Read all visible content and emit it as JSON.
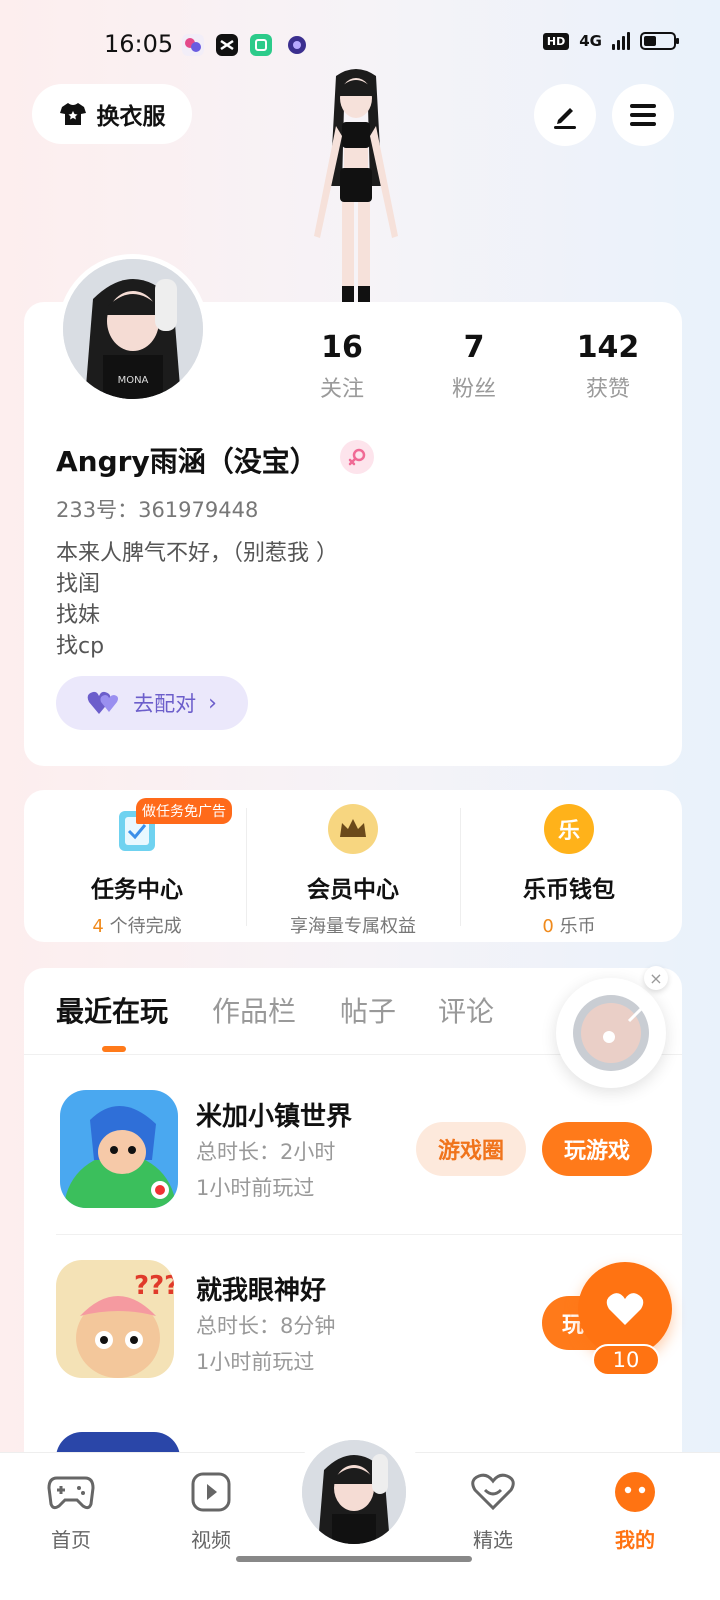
{
  "status_bar": {
    "time": "16:05",
    "network": "4G",
    "hd": "HD",
    "app_icons": [
      "app-icon-1",
      "capcut-icon",
      "app-icon-3",
      "app-icon-4"
    ]
  },
  "top_bar": {
    "outfit_label": "换衣服",
    "edit_icon": "pen-icon",
    "menu_icon": "menu-icon"
  },
  "profile": {
    "name": "Angry雨涵（没宝）",
    "gender_icon": "female-icon",
    "uid": "233号：361979448",
    "bio": [
      "本来人脾气不好，（别惹我 ）",
      "找闺",
      "找妹",
      "找cp"
    ],
    "match_label": "去配对",
    "stats": [
      {
        "value": "16",
        "label": "关注"
      },
      {
        "value": "7",
        "label": "粉丝"
      },
      {
        "value": "142",
        "label": "获赞"
      }
    ]
  },
  "features": {
    "task_badge": "做任务免广告",
    "items": [
      {
        "title": "任务中心",
        "count": "4",
        "sub": " 个待完成"
      },
      {
        "title": "会员中心",
        "count": "",
        "sub": "享海量专属权益"
      },
      {
        "title": "乐币钱包",
        "count": "0",
        "sub": " 乐币"
      }
    ],
    "coin_glyph": "乐"
  },
  "tabs": [
    "最近在玩",
    "作品栏",
    "帖子",
    "评论"
  ],
  "games": [
    {
      "title": "米加小镇世界",
      "duration": "总时长：2小时",
      "last_played": "1小时前玩过",
      "circle_label": "游戏圈",
      "play_label": "玩游戏"
    },
    {
      "title": "就我眼神好",
      "duration": "总时长：8分钟",
      "last_played": "1小时前玩过",
      "play_label": "玩"
    }
  ],
  "floating": {
    "close": "×",
    "like_count": "10"
  },
  "bottom_nav": [
    {
      "label": "首页",
      "active": false
    },
    {
      "label": "视频",
      "active": false
    },
    {
      "label": "精选",
      "active": false
    },
    {
      "label": "我的",
      "active": true
    }
  ],
  "colors": {
    "accent": "#ff7312",
    "match": "#6c5ecb"
  }
}
